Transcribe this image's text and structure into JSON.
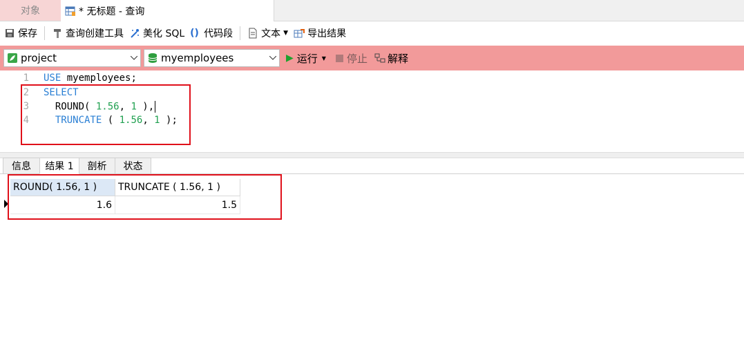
{
  "tabs": {
    "objects": "对象",
    "query": "* 无标题 - 查询"
  },
  "toolbar": {
    "save": "保存",
    "query_builder": "查询创建工具",
    "beautify_sql": "美化 SQL",
    "snippet": "代码段",
    "text": "文本",
    "export": "导出结果"
  },
  "selectors": {
    "connection": "project",
    "database": "myemployees",
    "run": "运行",
    "stop": "停止",
    "explain": "解释"
  },
  "editor": {
    "line_numbers": [
      "1",
      "2",
      "3",
      "4"
    ],
    "line1_kw": "USE",
    "line1_rest": " myemployees;",
    "line2_kw": "SELECT",
    "line3_fn": "  ROUND( ",
    "line3_a": "1.56",
    "line3_mid": ", ",
    "line3_b": "1",
    "line3_end": " ),",
    "line4_fn": "  TRUNCATE",
    "line4_open": " ( ",
    "line4_a": "1.56",
    "line4_mid": ", ",
    "line4_b": "1",
    "line4_end": " );"
  },
  "result_tabs": [
    "信息",
    "结果 1",
    "剖析",
    "状态"
  ],
  "grid": {
    "columns": [
      "ROUND( 1.56, 1 )",
      "TRUNCATE ( 1.56, 1 )"
    ],
    "rows": [
      [
        "1.6",
        "1.5"
      ]
    ]
  },
  "colors": {
    "selector_bar": "#f29a9a",
    "highlight_box": "#e0101a",
    "keyword": "#2a7fd4",
    "number": "#20a050"
  }
}
